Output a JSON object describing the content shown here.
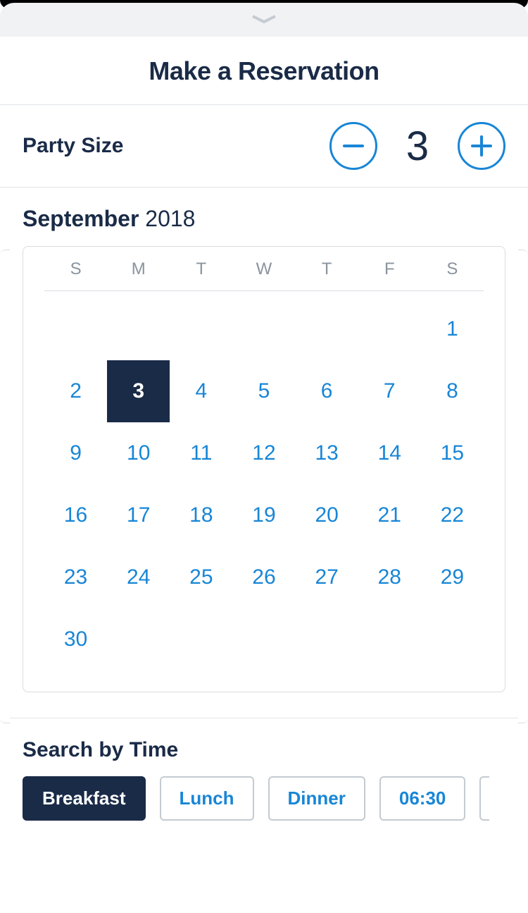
{
  "title": "Make a Reservation",
  "party_size": {
    "label": "Party Size",
    "value": "3"
  },
  "calendar": {
    "month": "September",
    "year": "2018",
    "day_headers": [
      "S",
      "M",
      "T",
      "W",
      "T",
      "F",
      "S"
    ],
    "selected_day": 3,
    "weeks": [
      [
        "",
        "",
        "",
        "",
        "",
        "",
        "1"
      ],
      [
        "2",
        "3",
        "4",
        "5",
        "6",
        "7",
        "8"
      ],
      [
        "9",
        "10",
        "11",
        "12",
        "13",
        "14",
        "15"
      ],
      [
        "16",
        "17",
        "18",
        "19",
        "20",
        "21",
        "22"
      ],
      [
        "23",
        "24",
        "25",
        "26",
        "27",
        "28",
        "29"
      ],
      [
        "30",
        "",
        "",
        "",
        "",
        "",
        ""
      ]
    ]
  },
  "search_time": {
    "label": "Search by Time",
    "options": [
      {
        "label": "Breakfast",
        "selected": true
      },
      {
        "label": "Lunch",
        "selected": false
      },
      {
        "label": "Dinner",
        "selected": false
      },
      {
        "label": "06:30",
        "selected": false
      }
    ]
  }
}
